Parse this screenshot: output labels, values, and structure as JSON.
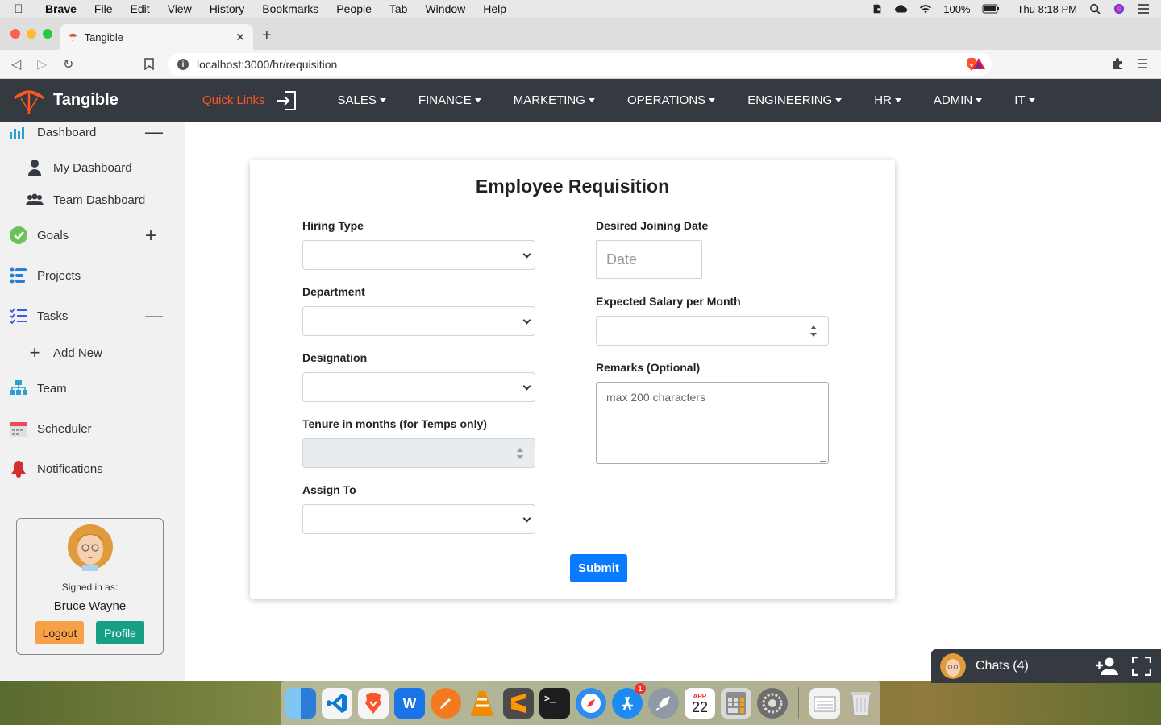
{
  "menubar": {
    "app": "Brave",
    "items": [
      "File",
      "Edit",
      "View",
      "History",
      "Bookmarks",
      "People",
      "Tab",
      "Window",
      "Help"
    ],
    "battery": "100%",
    "clock": "Thu 8:18 PM"
  },
  "browser": {
    "tab_title": "Tangible",
    "url": "localhost:3000/hr/requisition"
  },
  "navbar": {
    "brand": "Tangible",
    "quick_links": "Quick Links",
    "menus": [
      "SALES",
      "FINANCE",
      "MARKETING",
      "OPERATIONS",
      "ENGINEERING",
      "HR",
      "ADMIN",
      "IT"
    ]
  },
  "sidebar": {
    "dashboard": "Dashboard",
    "my_dashboard": "My Dashboard",
    "team_dashboard": "Team Dashboard",
    "goals": "Goals",
    "projects": "Projects",
    "tasks": "Tasks",
    "add_new": "Add New",
    "team": "Team",
    "scheduler": "Scheduler",
    "notifications": "Notifications",
    "user": {
      "signed_in_label": "Signed in as:",
      "name": "Bruce Wayne",
      "logout": "Logout",
      "profile": "Profile"
    }
  },
  "form": {
    "title": "Employee Requisition",
    "hiring_type": "Hiring Type",
    "department": "Department",
    "designation": "Designation",
    "tenure": "Tenure in months (for Temps only)",
    "assign_to": "Assign To",
    "joining_date": "Desired Joining Date",
    "date_placeholder": "Date",
    "salary": "Expected Salary per Month",
    "remarks": "Remarks (Optional)",
    "remarks_placeholder": "max 200 characters",
    "submit": "Submit"
  },
  "chat": {
    "title": "Chats (4)"
  },
  "dock": {
    "calendar_month": "APR",
    "calendar_day": "22",
    "appstore_badge": "1"
  },
  "colors": {
    "navbar_bg": "#343a40",
    "quick_links": "#ff5722",
    "submit": "#0a7bff",
    "logout": "#f7a046",
    "profile": "#17a085"
  }
}
